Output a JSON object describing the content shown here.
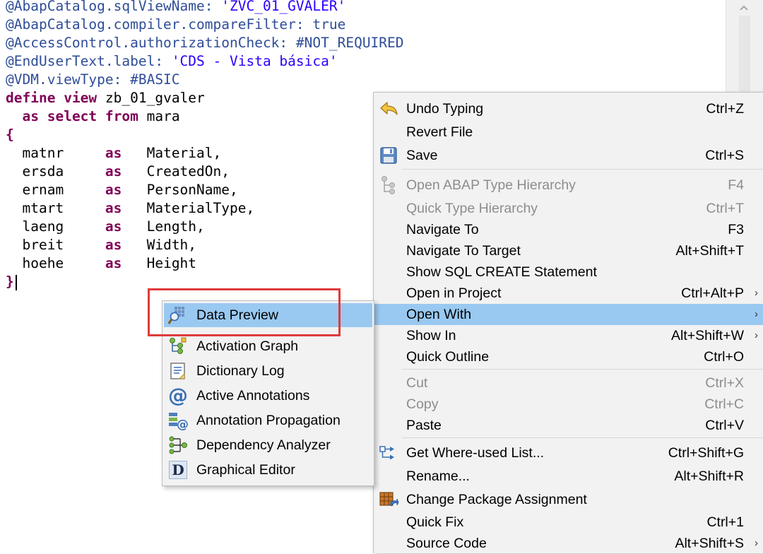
{
  "editor": {
    "lines": [
      {
        "parts": [
          {
            "t": "@AbapCatalog.sqlViewName: ",
            "c": "ann"
          },
          {
            "t": "'ZVC_01_GVALER'",
            "c": "str"
          }
        ]
      },
      {
        "parts": [
          {
            "t": "@AbapCatalog.compiler.compareFilter: true",
            "c": "ann"
          }
        ]
      },
      {
        "parts": [
          {
            "t": "@AccessControl.authorizationCheck: #NOT_REQUIRED",
            "c": "ann"
          }
        ]
      },
      {
        "parts": [
          {
            "t": "@EndUserText.label: ",
            "c": "ann"
          },
          {
            "t": "'CDS - Vista básica'",
            "c": "str"
          }
        ]
      },
      {
        "parts": [
          {
            "t": "@VDM.viewType: #BASIC",
            "c": "ann"
          }
        ]
      },
      {
        "parts": [
          {
            "t": "define",
            "c": "kw"
          },
          {
            "t": " ",
            "c": "plain"
          },
          {
            "t": "view",
            "c": "kw"
          },
          {
            "t": " zb_01_gvaler",
            "c": "plain"
          }
        ]
      },
      {
        "parts": [
          {
            "t": "  ",
            "c": "plain"
          },
          {
            "t": "as",
            "c": "kw"
          },
          {
            "t": " ",
            "c": "plain"
          },
          {
            "t": "select",
            "c": "kw"
          },
          {
            "t": " ",
            "c": "plain"
          },
          {
            "t": "from",
            "c": "kw"
          },
          {
            "t": " mara",
            "c": "plain"
          }
        ]
      },
      {
        "parts": [
          {
            "t": "{",
            "c": "kw"
          }
        ]
      },
      {
        "parts": [
          {
            "t": "  matnr     ",
            "c": "plain"
          },
          {
            "t": "as",
            "c": "kw"
          },
          {
            "t": "   Material,",
            "c": "plain"
          }
        ]
      },
      {
        "parts": [
          {
            "t": "  ersda     ",
            "c": "plain"
          },
          {
            "t": "as",
            "c": "kw"
          },
          {
            "t": "   CreatedOn,",
            "c": "plain"
          }
        ]
      },
      {
        "parts": [
          {
            "t": "  ernam     ",
            "c": "plain"
          },
          {
            "t": "as",
            "c": "kw"
          },
          {
            "t": "   PersonName,",
            "c": "plain"
          }
        ]
      },
      {
        "parts": [
          {
            "t": "  mtart     ",
            "c": "plain"
          },
          {
            "t": "as",
            "c": "kw"
          },
          {
            "t": "   MaterialType,",
            "c": "plain"
          }
        ]
      },
      {
        "parts": [
          {
            "t": "  laeng     ",
            "c": "plain"
          },
          {
            "t": "as",
            "c": "kw"
          },
          {
            "t": "   Length,",
            "c": "plain"
          }
        ]
      },
      {
        "parts": [
          {
            "t": "  breit     ",
            "c": "plain"
          },
          {
            "t": "as",
            "c": "kw"
          },
          {
            "t": "   Width,",
            "c": "plain"
          }
        ]
      },
      {
        "parts": [
          {
            "t": "  hoehe     ",
            "c": "plain"
          },
          {
            "t": "as",
            "c": "kw"
          },
          {
            "t": "   Height",
            "c": "plain"
          }
        ]
      },
      {
        "parts": [
          {
            "t": "}",
            "c": "kw"
          }
        ],
        "cursor": true
      }
    ]
  },
  "context_menu": {
    "items": {
      "undo": {
        "label": "Undo Typing",
        "accel": "Ctrl+Z",
        "icon": "undo-arrow-icon"
      },
      "revert": {
        "label": "Revert File",
        "accel": ""
      },
      "save": {
        "label": "Save",
        "accel": "Ctrl+S",
        "icon": "floppy-disk-icon"
      },
      "type_hierarchy": {
        "label": "Open ABAP Type Hierarchy",
        "accel": "F4",
        "icon": "hierarchy-icon"
      },
      "quick_type": {
        "label": "Quick Type Hierarchy",
        "accel": "Ctrl+T"
      },
      "navigate_to": {
        "label": "Navigate To",
        "accel": "F3"
      },
      "navigate_target": {
        "label": "Navigate To Target",
        "accel": "Alt+Shift+T"
      },
      "show_sql": {
        "label": "Show SQL CREATE Statement",
        "accel": ""
      },
      "open_project": {
        "label": "Open in Project",
        "accel": "Ctrl+Alt+P"
      },
      "open_with": {
        "label": "Open With",
        "accel": ""
      },
      "show_in": {
        "label": "Show In",
        "accel": "Alt+Shift+W"
      },
      "quick_outline": {
        "label": "Quick Outline",
        "accel": "Ctrl+O"
      },
      "cut": {
        "label": "Cut",
        "accel": "Ctrl+X"
      },
      "copy": {
        "label": "Copy",
        "accel": "Ctrl+C"
      },
      "paste": {
        "label": "Paste",
        "accel": "Ctrl+V"
      },
      "where_used": {
        "label": "Get Where-used List...",
        "accel": "Ctrl+Shift+G",
        "icon": "where-used-icon"
      },
      "rename": {
        "label": "Rename...",
        "accel": "Alt+Shift+R"
      },
      "package": {
        "label": "Change Package Assignment",
        "accel": "",
        "icon": "package-icon"
      },
      "quick_fix": {
        "label": "Quick Fix",
        "accel": "Ctrl+1"
      },
      "source_code": {
        "label": "Source Code",
        "accel": "Alt+Shift+S"
      }
    },
    "arrow_glyph": "›"
  },
  "submenu": {
    "data_preview": {
      "label": "Data Preview",
      "icon": "data-preview-icon"
    },
    "activation_graph": {
      "label": "Activation Graph",
      "icon": "activation-graph-icon"
    },
    "dictionary_log": {
      "label": "Dictionary Log",
      "icon": "dictionary-log-icon"
    },
    "active_annotations": {
      "label": "Active Annotations",
      "icon": "at-sign-icon"
    },
    "annotation_propagation": {
      "label": "Annotation Propagation",
      "icon": "annotation-propagation-icon"
    },
    "dependency_analyzer": {
      "label": "Dependency Analyzer",
      "icon": "dependency-analyzer-icon"
    },
    "graphical_editor": {
      "label": "Graphical Editor",
      "icon": "graphical-editor-icon"
    },
    "icon_letter_d": "D",
    "icon_at": "@"
  },
  "colors": {
    "annotation": "#2f4d98",
    "keyword": "#7f0055",
    "string": "#2a00ff",
    "highlight": "#99c9f1",
    "callout": "#e03a3a"
  }
}
